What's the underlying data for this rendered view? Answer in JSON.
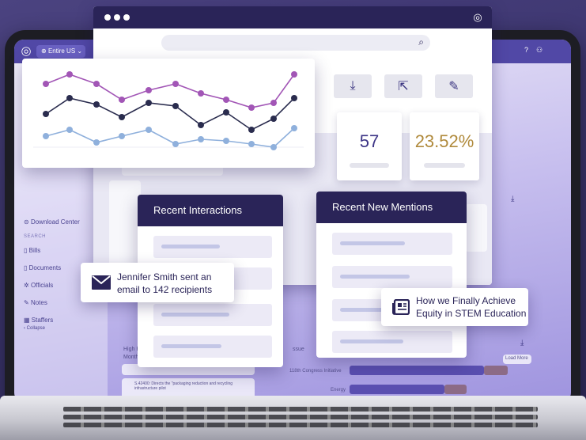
{
  "app": {
    "region": "Entire US",
    "sidebar": {
      "items": [
        "Download Center",
        "Bills",
        "Documents",
        "Officials",
        "Notes",
        "Staffers",
        "Collapse"
      ],
      "heads": [
        "SEARCH"
      ]
    },
    "background_text": {
      "high_priority": "High Pri",
      "month": "Month)",
      "issue": "ssue",
      "congress": "118th Congress Initiative",
      "energy": "Energy",
      "bill_snippet": "S.42400: Directs the \"packaging reduction and recycling infrastructure pilot",
      "load_more": "Load More"
    }
  },
  "stats": [
    {
      "value": "57",
      "color": "#3d3586"
    },
    {
      "value": "23.52%",
      "color": "#b08a3c"
    }
  ],
  "panels": {
    "interactions_title": "Recent Interactions",
    "mentions_title": "Recent New Mentions"
  },
  "callouts": {
    "email_line1": "Jennifer Smith sent an",
    "email_line2": "email to 142 recipients",
    "news_line1": "How we Finally Achieve",
    "news_line2": "Equity in STEM Education"
  },
  "colors": {
    "navy": "#2a2458",
    "purple_series": "#a256b6",
    "dark_series": "#2a2c4e",
    "blue_series": "#8fb0dc"
  },
  "icons": [
    "download-icon",
    "share-icon",
    "edit-icon",
    "search-icon",
    "email-icon",
    "newspaper-icon",
    "logo-icon"
  ]
}
